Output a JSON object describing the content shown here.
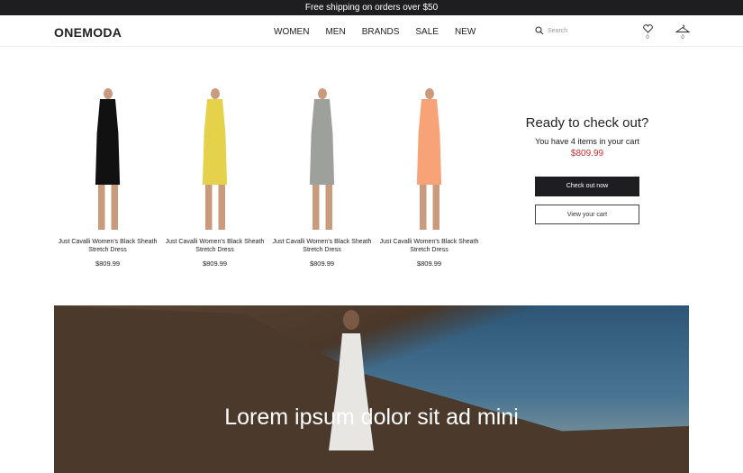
{
  "topbar": {
    "text": "Free shipping on orders over $50"
  },
  "header": {
    "logo": "ONEMODA",
    "nav": [
      "WOMEN",
      "MEN",
      "BRANDS",
      "SALE",
      "NEW"
    ],
    "search_placeholder": "Search",
    "wishlist_count": "0",
    "cart_count": "0"
  },
  "products": [
    {
      "name": "Just Cavalli Women's Black Sheath Stretch Dress",
      "price": "$809.99",
      "color": "#111111"
    },
    {
      "name": "Just Cavalli Women's Black Sheath Stretch Dress",
      "price": "$809.99",
      "color": "#e6d24a"
    },
    {
      "name": "Just Cavalli Women's Black Sheath Stretch Dress",
      "price": "$809.99",
      "color": "#9ea09c"
    },
    {
      "name": "Just Cavalli Women's Black Sheath Stretch Dress",
      "price": "$809.99",
      "color": "#f7a277"
    }
  ],
  "checkout": {
    "title": "Ready to check out?",
    "items": "You have 4 items in your cart",
    "total": "$809.99",
    "primary": "Check out now",
    "secondary": "View your cart"
  },
  "hero": {
    "text": "Lorem ipsum dolor sit ad mini"
  }
}
